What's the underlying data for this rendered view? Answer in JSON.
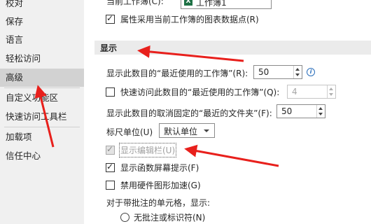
{
  "sidebar": {
    "items": [
      {
        "label": "校对"
      },
      {
        "label": "保存"
      },
      {
        "label": "语言"
      },
      {
        "label": "轻松访问"
      },
      {
        "label": "高级"
      },
      {
        "label": "自定义功能区"
      },
      {
        "label": "快速访问工具栏"
      },
      {
        "label": "加载项"
      },
      {
        "label": "信任中心"
      }
    ],
    "selected": "高级"
  },
  "workbook_options": {
    "current_workbook_label": "当前工作簿(C):",
    "current_workbook_value": "工作簿1",
    "data_point_label": "属性采用当前工作簿的图表数据点(R)"
  },
  "display": {
    "header": "显示",
    "recent_workbooks_label": "显示此数目的“最近使用的工作簿”(R):",
    "recent_workbooks_value": "50",
    "quick_access_label": "快速访问此数目的“最近使用的工作簿”(Q):",
    "quick_access_value": "4",
    "unpinned_folders_label": "显示此数目的取消固定的“最近的文件夹”(F):",
    "unpinned_folders_value": "50",
    "ruler_units_label": "标尺单位(U)",
    "ruler_units_value": "默认单位",
    "show_formula_bar": "显示编辑栏(U)",
    "show_function_tooltips": "显示函数屏幕提示(F)",
    "disable_hw_accel": "禁用硬件图形加速(G)",
    "comment_cells_label": "对于带批注的单元格，显示:",
    "no_comments_option": "无批注或标识符(N)"
  },
  "colors": {
    "arrow": "#e8201c",
    "selected_nav": "#d2d2d2",
    "excel_green": "#1e7145"
  }
}
